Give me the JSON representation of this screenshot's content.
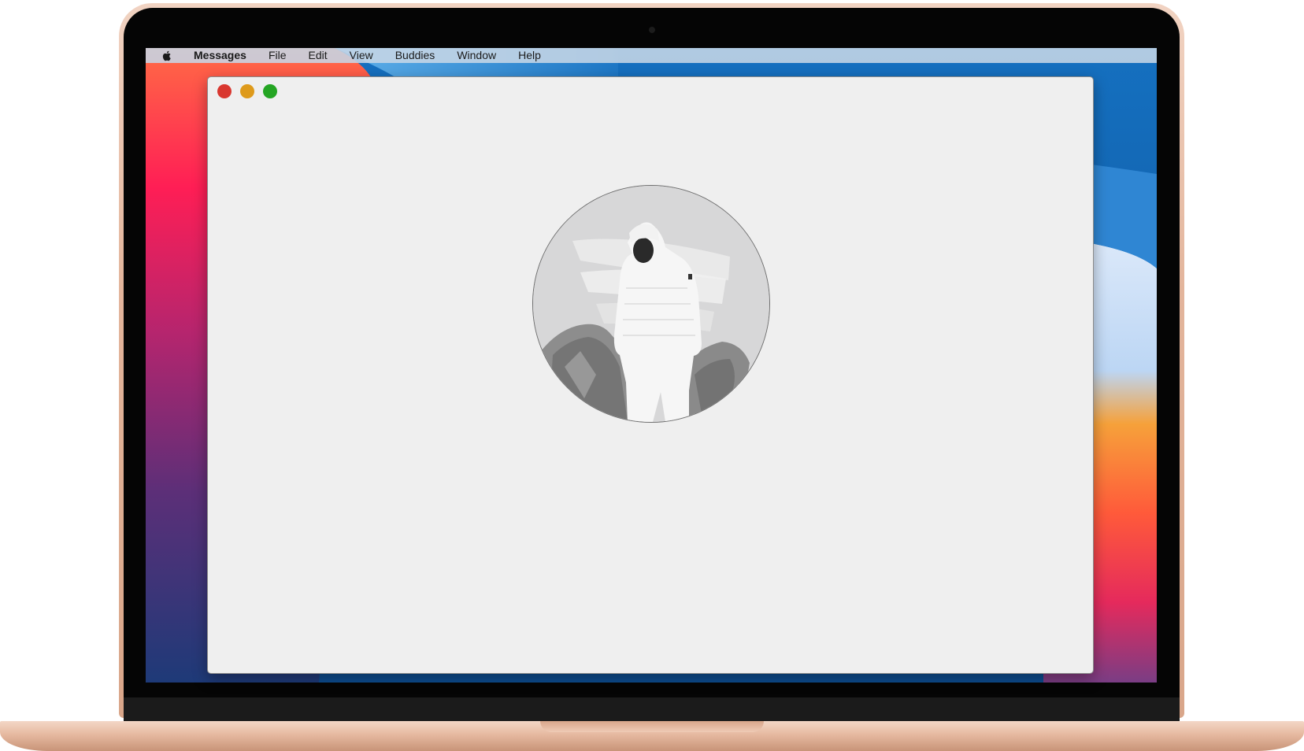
{
  "menubar": {
    "apple_icon": "apple-logo-icon",
    "app_name": "Messages",
    "items": [
      "File",
      "Edit",
      "View",
      "Buddies",
      "Window",
      "Help"
    ]
  },
  "window": {
    "controls": [
      "close",
      "minimize",
      "zoom"
    ],
    "avatar_description": "profile-photo"
  },
  "colors": {
    "close": "#d9372f",
    "minimize": "#de9a1b",
    "zoom": "#24a523",
    "window_background": "#efefef"
  }
}
